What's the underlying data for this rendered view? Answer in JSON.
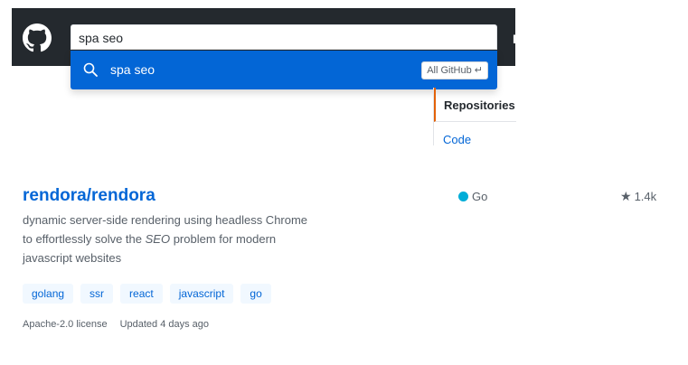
{
  "header": {
    "logo_icon": "github-logo-icon",
    "cut_text": "P",
    "search": {
      "value": "spa seo",
      "suggestion_text": "spa seo",
      "suggestion_icon": "search-icon",
      "scope_badge": "All GitHub ↵"
    }
  },
  "sidebar": {
    "active_item": "Repositories",
    "next_item": "Code"
  },
  "result": {
    "repo_name": "rendora/rendora",
    "description": {
      "part1": "dynamic server-side rendering using headless Chrome to effortlessly solve the ",
      "emphasis": "SEO",
      "part2": " problem for modern javascript websites"
    },
    "language": "Go",
    "language_color": "#00add8",
    "stars": "1.4k",
    "topics": [
      "golang",
      "ssr",
      "react",
      "javascript",
      "go"
    ],
    "license": "Apache-2.0 license",
    "updated": "Updated 4 days ago"
  },
  "colors": {
    "header_bg": "#24292e",
    "accent": "#0366d6",
    "topic_bg": "#f1f8ff",
    "active_tab_border": "#e36209"
  }
}
